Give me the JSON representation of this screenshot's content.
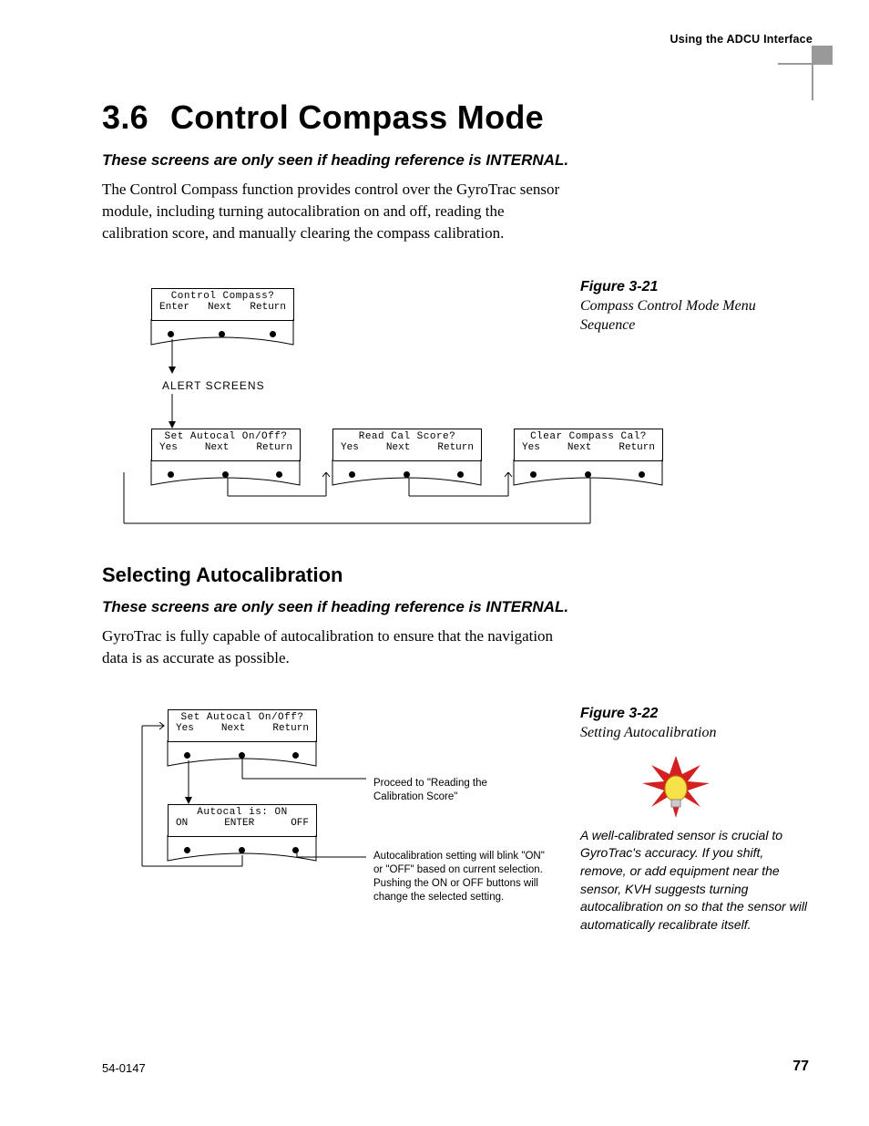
{
  "header": {
    "section": "Using the ADCU Interface"
  },
  "title": {
    "num": "3.6",
    "text": "Control Compass Mode"
  },
  "note1": "These screens are only seen if heading reference is INTERNAL.",
  "p1": "The Control Compass function provides control over the GyroTrac sensor module, including turning autocalibration on and off, reading the calibration score, and manually clearing the compass calibration.",
  "fig21": {
    "label": "Figure 3-21",
    "desc": "Compass Control Mode Menu Sequence"
  },
  "diagram1": {
    "top": {
      "title": "Control Compass?",
      "l": "Enter",
      "m": "Next",
      "r": "Return"
    },
    "alert": "ALERT SCREENS",
    "b1": {
      "title": "Set Autocal On/Off?",
      "l": "Yes",
      "m": "Next",
      "r": "Return"
    },
    "b2": {
      "title": "Read Cal Score?",
      "l": "Yes",
      "m": "Next",
      "r": "Return"
    },
    "b3": {
      "title": "Clear Compass Cal?",
      "l": "Yes",
      "m": "Next",
      "r": "Return"
    }
  },
  "sub1": "Selecting Autocalibration",
  "note2": "These screens are only seen if heading reference is INTERNAL.",
  "p2": "GyroTrac is fully capable of autocalibration to ensure that the navigation data is as accurate as possible.",
  "fig22": {
    "label": "Figure 3-22",
    "desc": "Setting Autocalibration"
  },
  "diagram2": {
    "top": {
      "title": "Set Autocal On/Off?",
      "l": "Yes",
      "m": "Next",
      "r": "Return"
    },
    "bot": {
      "title": "Autocal is: ON",
      "l": "ON",
      "m": "ENTER",
      "r": "OFF"
    },
    "ann1": "Proceed to \"Reading the Calibration Score\"",
    "ann2": "Autocalibration setting will blink \"ON\" or \"OFF\" based on current selection. Pushing the ON or OFF buttons will change the selected setting."
  },
  "sidenote": "A well-calibrated sensor is crucial to GyroTrac's accuracy. If you shift, remove, or add equipment near the sensor, KVH suggests turning autocalibration on so that the sensor will automatically recalibrate itself.",
  "footer": {
    "left": "54-0147",
    "right": "77"
  }
}
